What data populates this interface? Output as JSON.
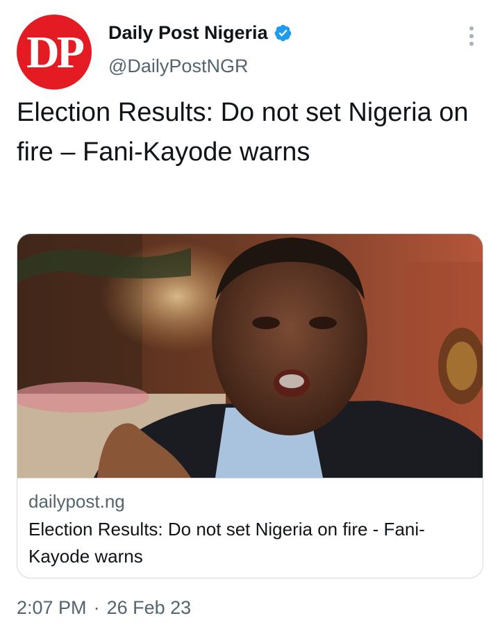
{
  "author": {
    "avatar_text": "DP",
    "avatar_color": "#e51b23",
    "display_name": "Daily Post Nigeria",
    "handle": "@DailyPostNGR",
    "verified": true,
    "verified_color": "#1d9bf0"
  },
  "tweet": {
    "text": "Election Results: Do not set Nigeria on fire – Fani-Kayode warns",
    "time": "2:07 PM",
    "separator": "·",
    "date": "26 Feb 23"
  },
  "card": {
    "image_icon": "news-photo-man-speaking",
    "domain": "dailypost.ng",
    "title": "Election Results: Do not set Nigeria on fire - Fani-Kayode warns"
  },
  "menu_icon": "more-options-vertical-icon"
}
